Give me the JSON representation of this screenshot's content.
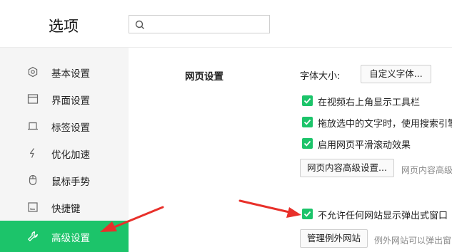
{
  "header": {
    "title": "选项",
    "search_placeholder": ""
  },
  "sidebar": {
    "items": [
      {
        "label": "基本设置",
        "icon": "gear-icon"
      },
      {
        "label": "界面设置",
        "icon": "window-icon"
      },
      {
        "label": "标签设置",
        "icon": "tab-icon"
      },
      {
        "label": "优化加速",
        "icon": "lightning-icon"
      },
      {
        "label": "鼠标手势",
        "icon": "mouse-icon"
      },
      {
        "label": "快捷键",
        "icon": "keyboard-icon"
      },
      {
        "label": "高级设置",
        "icon": "wrench-icon",
        "active": true
      }
    ]
  },
  "main": {
    "section_title": "网页设置",
    "font_size_label": "字体大小:",
    "custom_font_button": "自定义字体...",
    "checkboxes": [
      {
        "label": "在视频右上角显示工具栏",
        "checked": true
      },
      {
        "label": "拖放选中的文字时，使用搜索引擎",
        "checked": true
      },
      {
        "label": "启用网页平滑滚动效果",
        "checked": true
      }
    ],
    "advanced_content_button": "网页内容高级设置...",
    "advanced_content_hint": "网页内容高级",
    "popup_checkbox": {
      "label": "不允许任何网站显示弹出式窗口",
      "checked": true
    },
    "manage_exceptions_button": "管理例外网站",
    "exceptions_hint": "例外网站可以弹出窗"
  },
  "colors": {
    "accent": "#1cc46a",
    "arrow": "#e8302a",
    "sidebar_bg": "#f5f5f5"
  }
}
